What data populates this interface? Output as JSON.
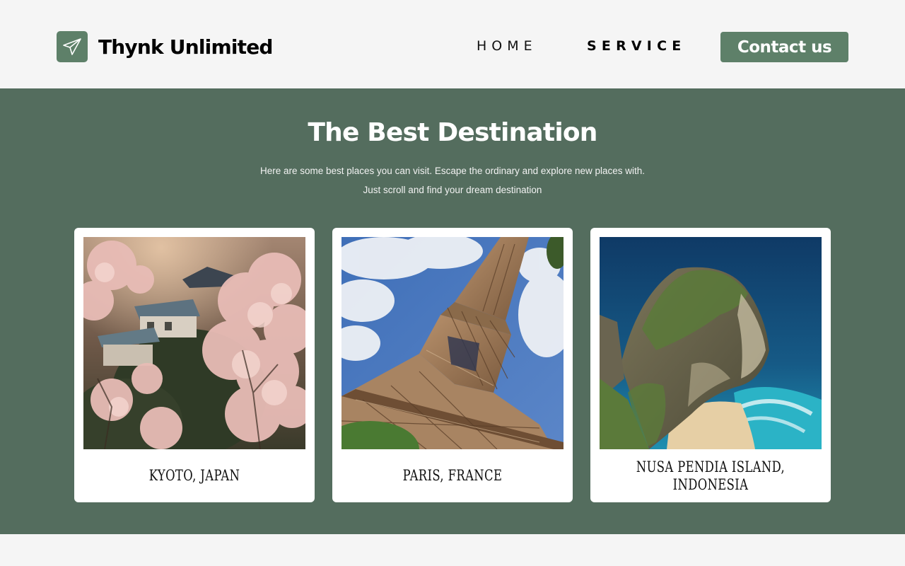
{
  "header": {
    "brand_name": "Thynk Unlimited",
    "logo_icon": "paper-plane-icon",
    "nav": {
      "home": "HOME",
      "service": "SERVICE"
    },
    "contact_button": "Contact us"
  },
  "section": {
    "title": "The Best Destination",
    "description_line1": "Here are some best places you can visit. Escape the ordinary and explore new places with.",
    "description_line2": "Just scroll and find your dream destination"
  },
  "destinations": [
    {
      "name": "KYOTO, JAPAN",
      "image": "cherry-blossom-house-photo"
    },
    {
      "name": "PARIS, FRANCE",
      "image": "eiffel-tower-photo"
    },
    {
      "name_line1": "NUSA PENDIA ISLAND,",
      "name_line2": "INDONESIA",
      "image": "cliff-beach-photo"
    }
  ],
  "colors": {
    "brand_green": "#5e8069",
    "section_background": "#546d5e",
    "page_background": "#f5f5f5"
  }
}
